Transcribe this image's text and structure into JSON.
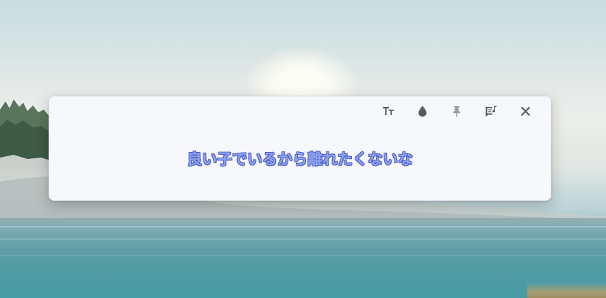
{
  "window": {
    "lyric_text": "良い子でいるから離れたくないな"
  },
  "toolbar": {
    "buttons": [
      {
        "name": "font-size-icon",
        "glyph": "Tт"
      },
      {
        "name": "color-drop-icon"
      },
      {
        "name": "pin-icon"
      },
      {
        "name": "lyrics-settings-icon"
      },
      {
        "name": "close-icon"
      }
    ]
  },
  "colors": {
    "lyric_fill": "#8aa3ee",
    "lyric_outline": "#5560c8",
    "icon_dark": "#555a60",
    "icon_muted": "#9a9ea3",
    "window_bg": "#f7f8fc"
  }
}
